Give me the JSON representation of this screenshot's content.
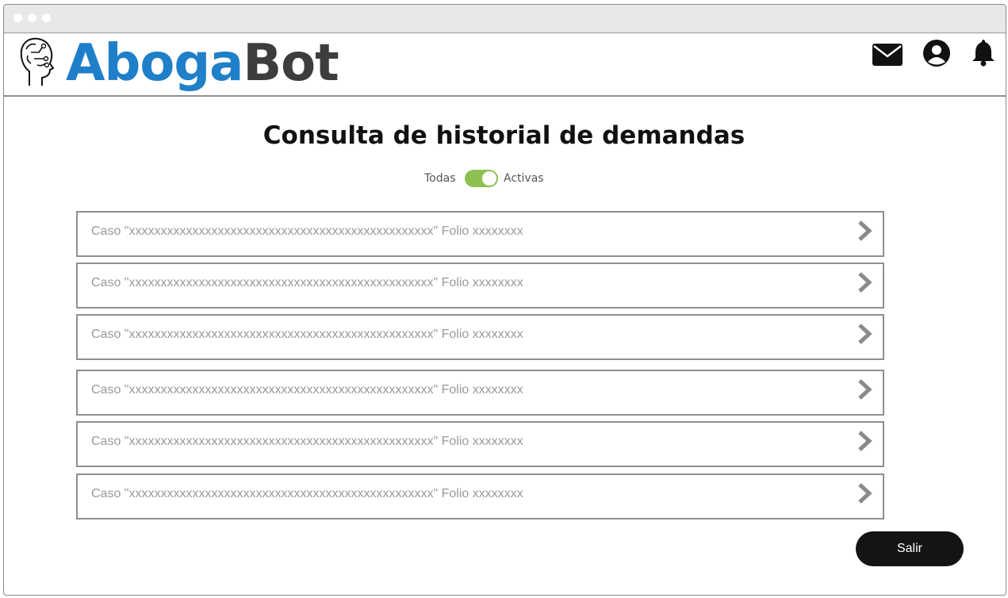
{
  "app": {
    "logo_part1": "Aboga",
    "logo_part2": "Bot",
    "brand_colors": {
      "blue": "#1f7fc8",
      "dark": "#3d3d3d"
    }
  },
  "header_icons": [
    "mail-icon",
    "user-icon",
    "bell-icon"
  ],
  "page": {
    "title": "Consulta de historial de demandas",
    "toggle": {
      "left_label": "Todas",
      "right_label": "Activas",
      "state": "Activas",
      "color": "#8cc152"
    }
  },
  "cases": [
    {
      "label": "Caso \"xxxxxxxxxxxxxxxxxxxxxxxxxxxxxxxxxxxxxxxxxxxxxxxx\" Folio xxxxxxxx"
    },
    {
      "label": "Caso \"xxxxxxxxxxxxxxxxxxxxxxxxxxxxxxxxxxxxxxxxxxxxxxxx\" Folio xxxxxxxx"
    },
    {
      "label": "Caso \"xxxxxxxxxxxxxxxxxxxxxxxxxxxxxxxxxxxxxxxxxxxxxxxx\" Folio xxxxxxxx"
    },
    {
      "label": "Caso \"xxxxxxxxxxxxxxxxxxxxxxxxxxxxxxxxxxxxxxxxxxxxxxxx\" Folio xxxxxxxx"
    },
    {
      "label": "Caso \"xxxxxxxxxxxxxxxxxxxxxxxxxxxxxxxxxxxxxxxxxxxxxxxx\" Folio xxxxxxxx"
    },
    {
      "label": "Caso \"xxxxxxxxxxxxxxxxxxxxxxxxxxxxxxxxxxxxxxxxxxxxxxxx\" Folio xxxxxxxx"
    }
  ],
  "actions": {
    "exit_label": "Salir"
  }
}
